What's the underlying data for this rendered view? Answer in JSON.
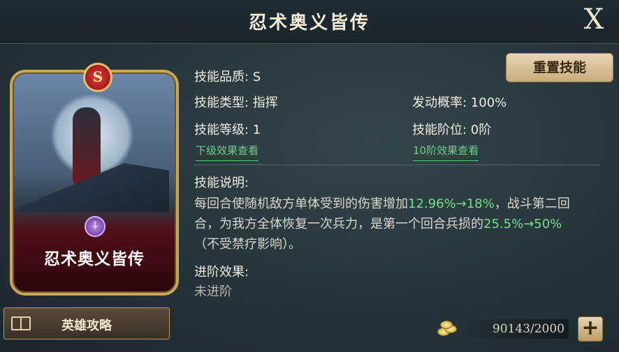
{
  "window": {
    "title": "忍术奥义皆传",
    "close_label": "X"
  },
  "reset_button": "重置技能",
  "card": {
    "grade_badge": "S",
    "name": "忍术奥义皆传",
    "emblem": "⸸"
  },
  "guide_button": "英雄攻略",
  "skill": {
    "quality": "技能品质: S",
    "type": "技能类型: 指挥",
    "level": "技能等级: 1",
    "trigger_rate": "发动概率: 100%",
    "tier": "技能阶位: 0阶",
    "link_next_level": "下级效果查看",
    "link_tier10": "10阶效果查看"
  },
  "description": {
    "heading": "技能说明:",
    "p1_a": "每回合使随机敌方单体受到的伤害增加",
    "p1_g": "12.96%→18%",
    "p1_b": "，战斗第二回合，为我方全体恢复一次兵力，是第一个回合兵损的",
    "p1_g2": "25.5%→50%",
    "p1_c": "（不受禁疗影响）。"
  },
  "advance": {
    "heading": "进阶效果:",
    "value": "未进阶"
  },
  "resource": {
    "count": "90143/2000",
    "plus_label": "+"
  },
  "icons": {
    "close": "close-icon",
    "book": "book-icon",
    "coins": "coins-icon",
    "plus": "plus-icon"
  },
  "colors": {
    "accent_green": "#73e08c",
    "gold": "#c9a55a"
  }
}
